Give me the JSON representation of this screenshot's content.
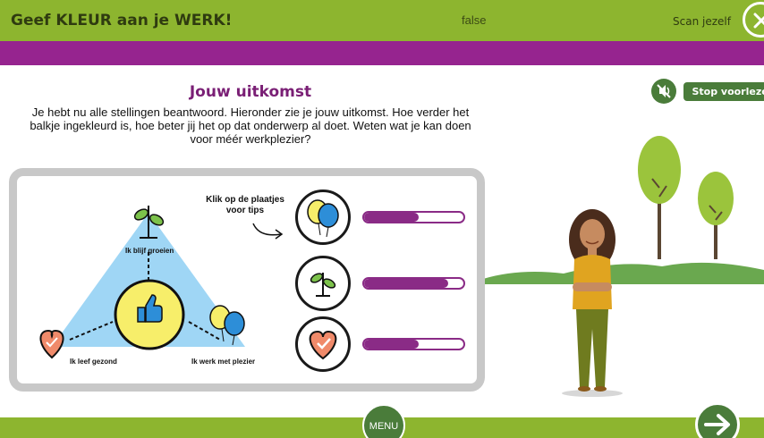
{
  "header": {
    "title": "Geef KLEUR aan je WERK!",
    "status": "false",
    "scan_label": "Scan jezelf"
  },
  "content": {
    "heading": "Jouw uitkomst",
    "intro": "Je hebt nu alle stellingen beantwoord. Hieronder zie je jouw uitkomst. Hoe verder het balkje ingekleurd is, hoe beter jij het op dat onderwerp al doet. Weten wat je kan doen voor méér werkplezier?",
    "stop_reading": "Stop voorlezen"
  },
  "diagram": {
    "top_label": "Ik blijf groeien",
    "left_label": "Ik leef gezond",
    "right_label": "Ik werk met plezier",
    "tip_text": "Klik op de plaatjes voor tips"
  },
  "results": [
    {
      "icon": "balloons-icon",
      "progress": 0.55
    },
    {
      "icon": "sprout-icon",
      "progress": 0.85
    },
    {
      "icon": "heart-icon",
      "progress": 0.55
    }
  ],
  "footer": {
    "menu_label": "MENU"
  },
  "colors": {
    "green": "#8db52f",
    "dark_green": "#4a7c3a",
    "purple": "#96248f",
    "bar_purple": "#8a2b86",
    "triangle_blue": "#9fd6f5",
    "yellow": "#f7ee6a"
  }
}
